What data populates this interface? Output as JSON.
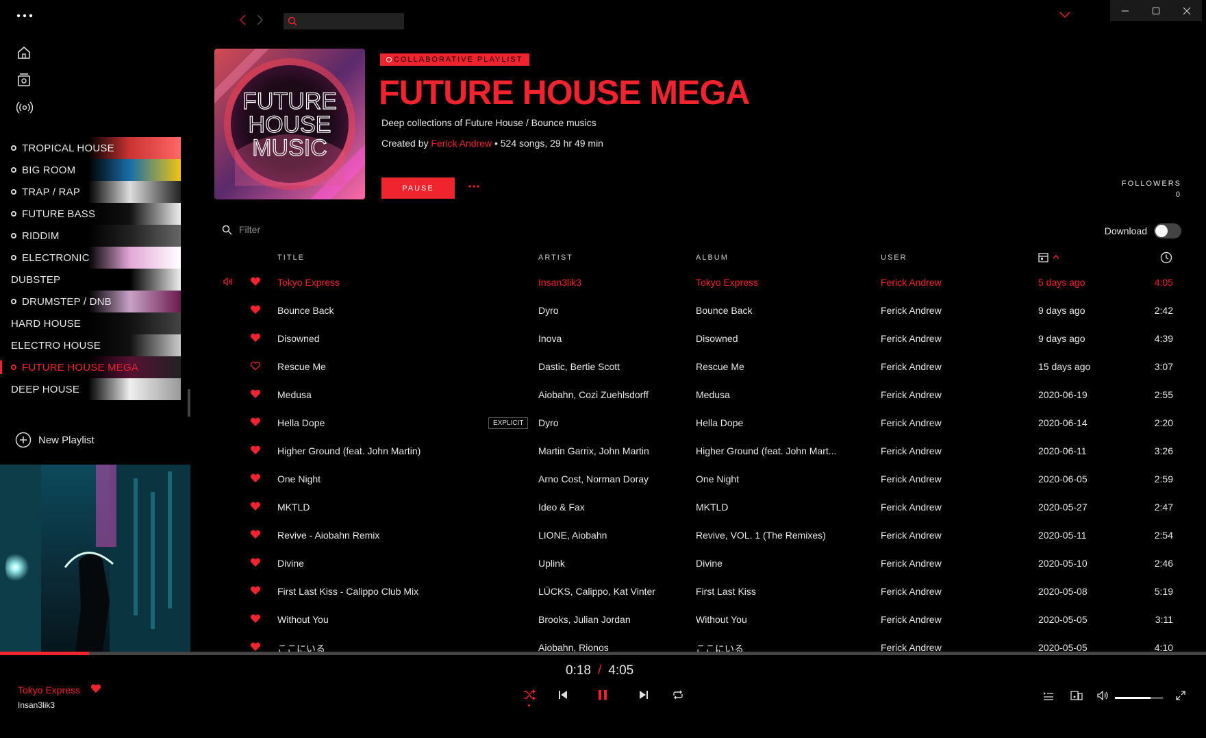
{
  "search": {
    "placeholder": ""
  },
  "sidebar": {
    "playlists": [
      {
        "label": "TROPICAL HOUSE",
        "dot": true,
        "active": false,
        "thumb": "#c33 #f66"
      },
      {
        "label": "BIG ROOM",
        "dot": true,
        "active": false,
        "thumb": "#1a6ea8 #f1c40f"
      },
      {
        "label": "TRAP / RAP",
        "dot": true,
        "active": false,
        "thumb": "#ddd #222"
      },
      {
        "label": "FUTURE BASS",
        "dot": true,
        "active": false,
        "thumb": "#111 #eee"
      },
      {
        "label": "RIDDIM",
        "dot": true,
        "active": false,
        "thumb": "#222 #666"
      },
      {
        "label": "ELECTRONIC",
        "dot": true,
        "active": false,
        "thumb": "#e3a6d8 #fff"
      },
      {
        "label": "DUBSTEP",
        "dot": false,
        "active": false,
        "thumb": "#000 #eee"
      },
      {
        "label": "DRUMSTEP / DNB",
        "dot": true,
        "active": false,
        "thumb": "#c8a2c8 #6a1b4d"
      },
      {
        "label": "HARD HOUSE",
        "dot": false,
        "active": false,
        "thumb": "#111 #444"
      },
      {
        "label": "ELECTRO HOUSE",
        "dot": false,
        "active": false,
        "thumb": "#111 #ccc"
      },
      {
        "label": "FUTURE HOUSE MEGA",
        "dot": true,
        "active": true,
        "thumb": "#551133 #222"
      },
      {
        "label": "DEEP HOUSE",
        "dot": false,
        "active": false,
        "thumb": "#eee #999"
      }
    ],
    "new_playlist": "New Playlist"
  },
  "header": {
    "badge": "COLLABORATIVE PLAYLIST",
    "title": "FUTURE HOUSE MEGA",
    "description": "Deep collections of Future House / Bounce musics",
    "created_by_prefix": "Created by",
    "creator": "Ferick Andrew",
    "stats": "• 524 songs, 29 hr 49 min",
    "pause_label": "PAUSE",
    "followers_label": "FOLLOWERS",
    "followers_count": "0",
    "art_lines": [
      "FUTURE",
      "HOUSE",
      "MUSIC"
    ]
  },
  "filter": {
    "placeholder": "Filter"
  },
  "download": {
    "label": "Download",
    "enabled": false
  },
  "table": {
    "columns": {
      "title": "TITLE",
      "artist": "ARTIST",
      "album": "ALBUM",
      "user": "USER"
    },
    "rows": [
      {
        "title": "Tokyo Express",
        "artist": "Insan3lik3",
        "album": "Tokyo Express",
        "user": "Ferick Andrew",
        "added": "5 days ago",
        "duration": "4:05",
        "liked": true,
        "playing": true,
        "explicit": false
      },
      {
        "title": "Bounce Back",
        "artist": "Dyro",
        "album": "Bounce Back",
        "user": "Ferick Andrew",
        "added": "9 days ago",
        "duration": "2:42",
        "liked": true,
        "playing": false,
        "explicit": false
      },
      {
        "title": "Disowned",
        "artist": "Inova",
        "album": "Disowned",
        "user": "Ferick Andrew",
        "added": "9 days ago",
        "duration": "4:39",
        "liked": true,
        "playing": false,
        "explicit": false
      },
      {
        "title": "Rescue Me",
        "artist": "Dastic, Bertie Scott",
        "album": "Rescue Me",
        "user": "Ferick Andrew",
        "added": "15 days ago",
        "duration": "3:07",
        "liked": false,
        "playing": false,
        "explicit": false
      },
      {
        "title": "Medusa",
        "artist": "Aiobahn, Cozi Zuehlsdorff",
        "album": "Medusa",
        "user": "Ferick Andrew",
        "added": "2020-06-19",
        "duration": "2:55",
        "liked": true,
        "playing": false,
        "explicit": false
      },
      {
        "title": "Hella Dope",
        "artist": "Dyro",
        "album": "Hella Dope",
        "user": "Ferick Andrew",
        "added": "2020-06-14",
        "duration": "2:20",
        "liked": true,
        "playing": false,
        "explicit": true
      },
      {
        "title": "Higher Ground (feat. John Martin)",
        "artist": "Martin Garrix, John Martin",
        "album": "Higher Ground (feat. John Mart...",
        "user": "Ferick Andrew",
        "added": "2020-06-11",
        "duration": "3:26",
        "liked": true,
        "playing": false,
        "explicit": false
      },
      {
        "title": "One Night",
        "artist": "Arno Cost, Norman Doray",
        "album": "One Night",
        "user": "Ferick Andrew",
        "added": "2020-06-05",
        "duration": "2:59",
        "liked": true,
        "playing": false,
        "explicit": false
      },
      {
        "title": "MKTLD",
        "artist": "Ideo & Fax",
        "album": "MKTLD",
        "user": "Ferick Andrew",
        "added": "2020-05-27",
        "duration": "2:47",
        "liked": true,
        "playing": false,
        "explicit": false
      },
      {
        "title": "Revive - Aiobahn Remix",
        "artist": "LIONE, Aiobahn",
        "album": "Revive, VOL. 1 (The Remixes)",
        "user": "Ferick Andrew",
        "added": "2020-05-11",
        "duration": "2:54",
        "liked": true,
        "playing": false,
        "explicit": false
      },
      {
        "title": "Divine",
        "artist": "Uplink",
        "album": "Divine",
        "user": "Ferick Andrew",
        "added": "2020-05-10",
        "duration": "2:46",
        "liked": true,
        "playing": false,
        "explicit": false
      },
      {
        "title": "First Last Kiss - Calippo Club Mix",
        "artist": "LÜCKS, Calippo, Kat Vinter",
        "album": "First Last Kiss",
        "user": "Ferick Andrew",
        "added": "2020-05-08",
        "duration": "5:19",
        "liked": true,
        "playing": false,
        "explicit": false
      },
      {
        "title": "Without You",
        "artist": "Brooks, Julian Jordan",
        "album": "Without You",
        "user": "Ferick Andrew",
        "added": "2020-05-05",
        "duration": "3:11",
        "liked": true,
        "playing": false,
        "explicit": false
      },
      {
        "title": "ここにいる",
        "artist": "Aiobahn, Rionos",
        "album": "ここにいる",
        "user": "Ferick Andrew",
        "added": "2020-05-05",
        "duration": "4:10",
        "liked": true,
        "playing": false,
        "explicit": false
      }
    ],
    "explicit_label": "EXPLICIT"
  },
  "player": {
    "title": "Tokyo Express",
    "artist": "Insan3lik3",
    "elapsed": "0:18",
    "separator": "/",
    "total": "4:05",
    "progress_fraction": 0.074,
    "volume_fraction": 0.74,
    "liked": true,
    "shuffle": true
  },
  "colors": {
    "accent": "#f0242e",
    "background": "#000000"
  }
}
